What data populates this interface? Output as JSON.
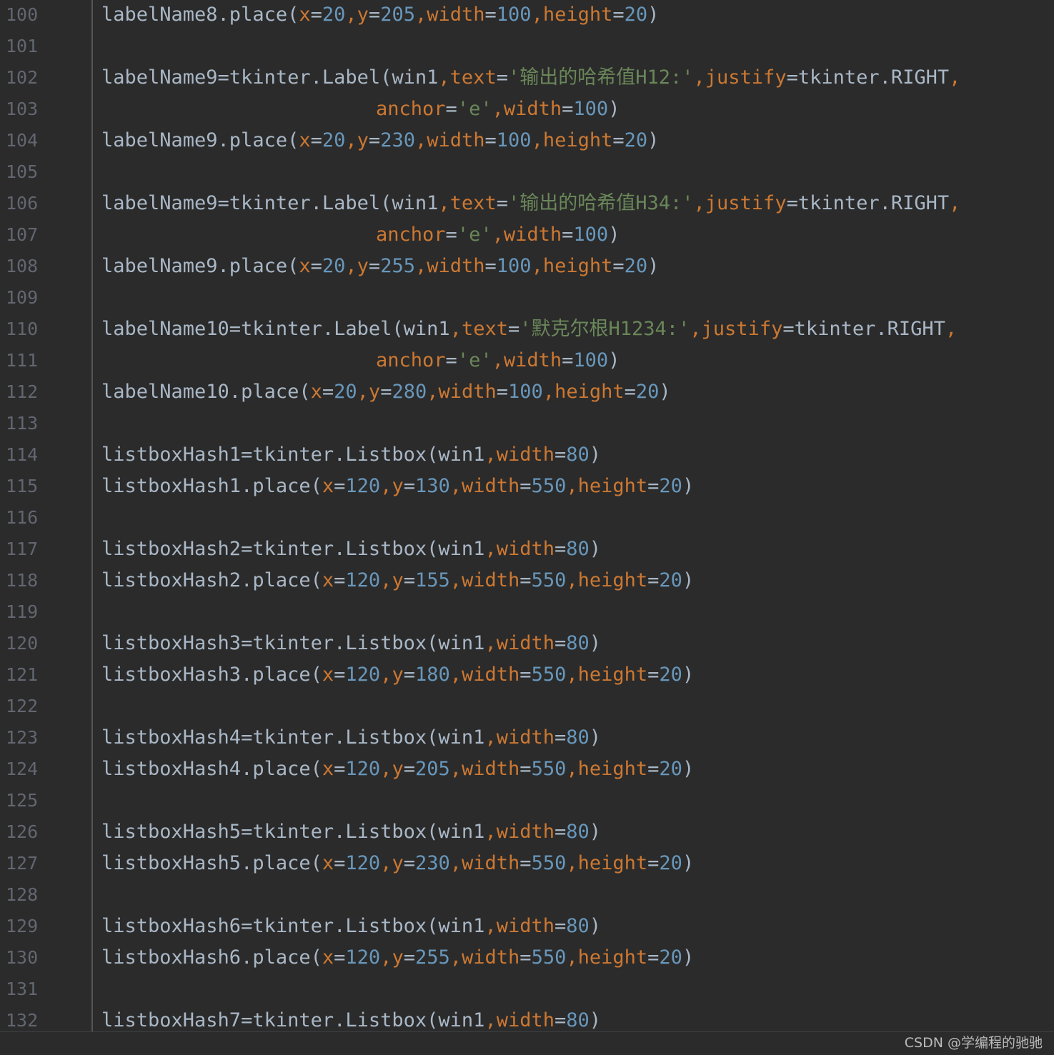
{
  "watermark": "CSDN @学编程的驰驰",
  "lines": [
    {
      "no": "100",
      "indent": 0,
      "tokens": [
        [
          "labelName8.place(",
          "t"
        ],
        [
          "x",
          "p"
        ],
        [
          "=",
          "t"
        ],
        [
          "20",
          "n"
        ],
        [
          ",",
          "p"
        ],
        [
          "y",
          "p"
        ],
        [
          "=",
          "t"
        ],
        [
          "205",
          "n"
        ],
        [
          ",",
          "p"
        ],
        [
          "width",
          "p"
        ],
        [
          "=",
          "t"
        ],
        [
          "100",
          "n"
        ],
        [
          ",",
          "p"
        ],
        [
          "height",
          "p"
        ],
        [
          "=",
          "t"
        ],
        [
          "20",
          "n"
        ],
        [
          ")",
          "t"
        ]
      ]
    },
    {
      "no": "101",
      "indent": 0,
      "tokens": []
    },
    {
      "no": "102",
      "indent": 0,
      "tokens": [
        [
          "labelName9=tkinter.Label(win1",
          "t"
        ],
        [
          ",",
          "p"
        ],
        [
          "text",
          "p"
        ],
        [
          "=",
          "t"
        ],
        [
          "'输出的哈希值H12:'",
          "s"
        ],
        [
          ",",
          "p"
        ],
        [
          "justify",
          "p"
        ],
        [
          "=tkinter.RIGHT",
          "t"
        ],
        [
          ",",
          "p"
        ]
      ]
    },
    {
      "no": "103",
      "indent": 1,
      "tokens": [
        [
          "anchor",
          "p"
        ],
        [
          "=",
          "t"
        ],
        [
          "'e'",
          "s"
        ],
        [
          ",",
          "p"
        ],
        [
          "width",
          "p"
        ],
        [
          "=",
          "t"
        ],
        [
          "100",
          "n"
        ],
        [
          ")",
          "t"
        ]
      ]
    },
    {
      "no": "104",
      "indent": 0,
      "tokens": [
        [
          "labelName9.place(",
          "t"
        ],
        [
          "x",
          "p"
        ],
        [
          "=",
          "t"
        ],
        [
          "20",
          "n"
        ],
        [
          ",",
          "p"
        ],
        [
          "y",
          "p"
        ],
        [
          "=",
          "t"
        ],
        [
          "230",
          "n"
        ],
        [
          ",",
          "p"
        ],
        [
          "width",
          "p"
        ],
        [
          "=",
          "t"
        ],
        [
          "100",
          "n"
        ],
        [
          ",",
          "p"
        ],
        [
          "height",
          "p"
        ],
        [
          "=",
          "t"
        ],
        [
          "20",
          "n"
        ],
        [
          ")",
          "t"
        ]
      ]
    },
    {
      "no": "105",
      "indent": 0,
      "tokens": []
    },
    {
      "no": "106",
      "indent": 0,
      "tokens": [
        [
          "labelName9=tkinter.Label(win1",
          "t"
        ],
        [
          ",",
          "p"
        ],
        [
          "text",
          "p"
        ],
        [
          "=",
          "t"
        ],
        [
          "'输出的哈希值H34:'",
          "s"
        ],
        [
          ",",
          "p"
        ],
        [
          "justify",
          "p"
        ],
        [
          "=tkinter.RIGHT",
          "t"
        ],
        [
          ",",
          "p"
        ]
      ]
    },
    {
      "no": "107",
      "indent": 1,
      "tokens": [
        [
          "anchor",
          "p"
        ],
        [
          "=",
          "t"
        ],
        [
          "'e'",
          "s"
        ],
        [
          ",",
          "p"
        ],
        [
          "width",
          "p"
        ],
        [
          "=",
          "t"
        ],
        [
          "100",
          "n"
        ],
        [
          ")",
          "t"
        ]
      ]
    },
    {
      "no": "108",
      "indent": 0,
      "tokens": [
        [
          "labelName9.place(",
          "t"
        ],
        [
          "x",
          "p"
        ],
        [
          "=",
          "t"
        ],
        [
          "20",
          "n"
        ],
        [
          ",",
          "p"
        ],
        [
          "y",
          "p"
        ],
        [
          "=",
          "t"
        ],
        [
          "255",
          "n"
        ],
        [
          ",",
          "p"
        ],
        [
          "width",
          "p"
        ],
        [
          "=",
          "t"
        ],
        [
          "100",
          "n"
        ],
        [
          ",",
          "p"
        ],
        [
          "height",
          "p"
        ],
        [
          "=",
          "t"
        ],
        [
          "20",
          "n"
        ],
        [
          ")",
          "t"
        ]
      ]
    },
    {
      "no": "109",
      "indent": 0,
      "tokens": []
    },
    {
      "no": "110",
      "indent": 0,
      "tokens": [
        [
          "labelName10=tkinter.Label(win1",
          "t"
        ],
        [
          ",",
          "p"
        ],
        [
          "text",
          "p"
        ],
        [
          "=",
          "t"
        ],
        [
          "'默克尔根H1234:'",
          "s"
        ],
        [
          ",",
          "p"
        ],
        [
          "justify",
          "p"
        ],
        [
          "=tkinter.RIGHT",
          "t"
        ],
        [
          ",",
          "p"
        ]
      ]
    },
    {
      "no": "111",
      "indent": 1,
      "tokens": [
        [
          "anchor",
          "p"
        ],
        [
          "=",
          "t"
        ],
        [
          "'e'",
          "s"
        ],
        [
          ",",
          "p"
        ],
        [
          "width",
          "p"
        ],
        [
          "=",
          "t"
        ],
        [
          "100",
          "n"
        ],
        [
          ")",
          "t"
        ]
      ]
    },
    {
      "no": "112",
      "indent": 0,
      "tokens": [
        [
          "labelName10.place(",
          "t"
        ],
        [
          "x",
          "p"
        ],
        [
          "=",
          "t"
        ],
        [
          "20",
          "n"
        ],
        [
          ",",
          "p"
        ],
        [
          "y",
          "p"
        ],
        [
          "=",
          "t"
        ],
        [
          "280",
          "n"
        ],
        [
          ",",
          "p"
        ],
        [
          "width",
          "p"
        ],
        [
          "=",
          "t"
        ],
        [
          "100",
          "n"
        ],
        [
          ",",
          "p"
        ],
        [
          "height",
          "p"
        ],
        [
          "=",
          "t"
        ],
        [
          "20",
          "n"
        ],
        [
          ")",
          "t"
        ]
      ]
    },
    {
      "no": "113",
      "indent": 0,
      "tokens": []
    },
    {
      "no": "114",
      "indent": 0,
      "tokens": [
        [
          "listboxHash1=tkinter.Listbox(win1",
          "t"
        ],
        [
          ",",
          "p"
        ],
        [
          "width",
          "p"
        ],
        [
          "=",
          "t"
        ],
        [
          "80",
          "n"
        ],
        [
          ")",
          "t"
        ]
      ]
    },
    {
      "no": "115",
      "indent": 0,
      "tokens": [
        [
          "listboxHash1.place(",
          "t"
        ],
        [
          "x",
          "p"
        ],
        [
          "=",
          "t"
        ],
        [
          "120",
          "n"
        ],
        [
          ",",
          "p"
        ],
        [
          "y",
          "p"
        ],
        [
          "=",
          "t"
        ],
        [
          "130",
          "n"
        ],
        [
          ",",
          "p"
        ],
        [
          "width",
          "p"
        ],
        [
          "=",
          "t"
        ],
        [
          "550",
          "n"
        ],
        [
          ",",
          "p"
        ],
        [
          "height",
          "p"
        ],
        [
          "=",
          "t"
        ],
        [
          "20",
          "n"
        ],
        [
          ")",
          "t"
        ]
      ]
    },
    {
      "no": "116",
      "indent": 0,
      "tokens": []
    },
    {
      "no": "117",
      "indent": 0,
      "tokens": [
        [
          "listboxHash2=tkinter.Listbox(win1",
          "t"
        ],
        [
          ",",
          "p"
        ],
        [
          "width",
          "p"
        ],
        [
          "=",
          "t"
        ],
        [
          "80",
          "n"
        ],
        [
          ")",
          "t"
        ]
      ]
    },
    {
      "no": "118",
      "indent": 0,
      "tokens": [
        [
          "listboxHash2.place(",
          "t"
        ],
        [
          "x",
          "p"
        ],
        [
          "=",
          "t"
        ],
        [
          "120",
          "n"
        ],
        [
          ",",
          "p"
        ],
        [
          "y",
          "p"
        ],
        [
          "=",
          "t"
        ],
        [
          "155",
          "n"
        ],
        [
          ",",
          "p"
        ],
        [
          "width",
          "p"
        ],
        [
          "=",
          "t"
        ],
        [
          "550",
          "n"
        ],
        [
          ",",
          "p"
        ],
        [
          "height",
          "p"
        ],
        [
          "=",
          "t"
        ],
        [
          "20",
          "n"
        ],
        [
          ")",
          "t"
        ]
      ]
    },
    {
      "no": "119",
      "indent": 0,
      "tokens": []
    },
    {
      "no": "120",
      "indent": 0,
      "tokens": [
        [
          "listboxHash3=tkinter.Listbox(win1",
          "t"
        ],
        [
          ",",
          "p"
        ],
        [
          "width",
          "p"
        ],
        [
          "=",
          "t"
        ],
        [
          "80",
          "n"
        ],
        [
          ")",
          "t"
        ]
      ]
    },
    {
      "no": "121",
      "indent": 0,
      "tokens": [
        [
          "listboxHash3.place(",
          "t"
        ],
        [
          "x",
          "p"
        ],
        [
          "=",
          "t"
        ],
        [
          "120",
          "n"
        ],
        [
          ",",
          "p"
        ],
        [
          "y",
          "p"
        ],
        [
          "=",
          "t"
        ],
        [
          "180",
          "n"
        ],
        [
          ",",
          "p"
        ],
        [
          "width",
          "p"
        ],
        [
          "=",
          "t"
        ],
        [
          "550",
          "n"
        ],
        [
          ",",
          "p"
        ],
        [
          "height",
          "p"
        ],
        [
          "=",
          "t"
        ],
        [
          "20",
          "n"
        ],
        [
          ")",
          "t"
        ]
      ]
    },
    {
      "no": "122",
      "indent": 0,
      "tokens": []
    },
    {
      "no": "123",
      "indent": 0,
      "tokens": [
        [
          "listboxHash4=tkinter.Listbox(win1",
          "t"
        ],
        [
          ",",
          "p"
        ],
        [
          "width",
          "p"
        ],
        [
          "=",
          "t"
        ],
        [
          "80",
          "n"
        ],
        [
          ")",
          "t"
        ]
      ]
    },
    {
      "no": "124",
      "indent": 0,
      "tokens": [
        [
          "listboxHash4.place(",
          "t"
        ],
        [
          "x",
          "p"
        ],
        [
          "=",
          "t"
        ],
        [
          "120",
          "n"
        ],
        [
          ",",
          "p"
        ],
        [
          "y",
          "p"
        ],
        [
          "=",
          "t"
        ],
        [
          "205",
          "n"
        ],
        [
          ",",
          "p"
        ],
        [
          "width",
          "p"
        ],
        [
          "=",
          "t"
        ],
        [
          "550",
          "n"
        ],
        [
          ",",
          "p"
        ],
        [
          "height",
          "p"
        ],
        [
          "=",
          "t"
        ],
        [
          "20",
          "n"
        ],
        [
          ")",
          "t"
        ]
      ]
    },
    {
      "no": "125",
      "indent": 0,
      "tokens": []
    },
    {
      "no": "126",
      "indent": 0,
      "tokens": [
        [
          "listboxHash5=tkinter.Listbox(win1",
          "t"
        ],
        [
          ",",
          "p"
        ],
        [
          "width",
          "p"
        ],
        [
          "=",
          "t"
        ],
        [
          "80",
          "n"
        ],
        [
          ")",
          "t"
        ]
      ]
    },
    {
      "no": "127",
      "indent": 0,
      "tokens": [
        [
          "listboxHash5.place(",
          "t"
        ],
        [
          "x",
          "p"
        ],
        [
          "=",
          "t"
        ],
        [
          "120",
          "n"
        ],
        [
          ",",
          "p"
        ],
        [
          "y",
          "p"
        ],
        [
          "=",
          "t"
        ],
        [
          "230",
          "n"
        ],
        [
          ",",
          "p"
        ],
        [
          "width",
          "p"
        ],
        [
          "=",
          "t"
        ],
        [
          "550",
          "n"
        ],
        [
          ",",
          "p"
        ],
        [
          "height",
          "p"
        ],
        [
          "=",
          "t"
        ],
        [
          "20",
          "n"
        ],
        [
          ")",
          "t"
        ]
      ]
    },
    {
      "no": "128",
      "indent": 0,
      "tokens": []
    },
    {
      "no": "129",
      "indent": 0,
      "tokens": [
        [
          "listboxHash6=tkinter.Listbox(win1",
          "t"
        ],
        [
          ",",
          "p"
        ],
        [
          "width",
          "p"
        ],
        [
          "=",
          "t"
        ],
        [
          "80",
          "n"
        ],
        [
          ")",
          "t"
        ]
      ]
    },
    {
      "no": "130",
      "indent": 0,
      "tokens": [
        [
          "listboxHash6.place(",
          "t"
        ],
        [
          "x",
          "p"
        ],
        [
          "=",
          "t"
        ],
        [
          "120",
          "n"
        ],
        [
          ",",
          "p"
        ],
        [
          "y",
          "p"
        ],
        [
          "=",
          "t"
        ],
        [
          "255",
          "n"
        ],
        [
          ",",
          "p"
        ],
        [
          "width",
          "p"
        ],
        [
          "=",
          "t"
        ],
        [
          "550",
          "n"
        ],
        [
          ",",
          "p"
        ],
        [
          "height",
          "p"
        ],
        [
          "=",
          "t"
        ],
        [
          "20",
          "n"
        ],
        [
          ")",
          "t"
        ]
      ]
    },
    {
      "no": "131",
      "indent": 0,
      "tokens": []
    },
    {
      "no": "132",
      "indent": 0,
      "tokens": [
        [
          "listboxHash7=tkinter.Listbox(win1",
          "t"
        ],
        [
          ",",
          "p"
        ],
        [
          "width",
          "p"
        ],
        [
          "=",
          "t"
        ],
        [
          "80",
          "n"
        ],
        [
          ")",
          "t"
        ]
      ]
    }
  ]
}
